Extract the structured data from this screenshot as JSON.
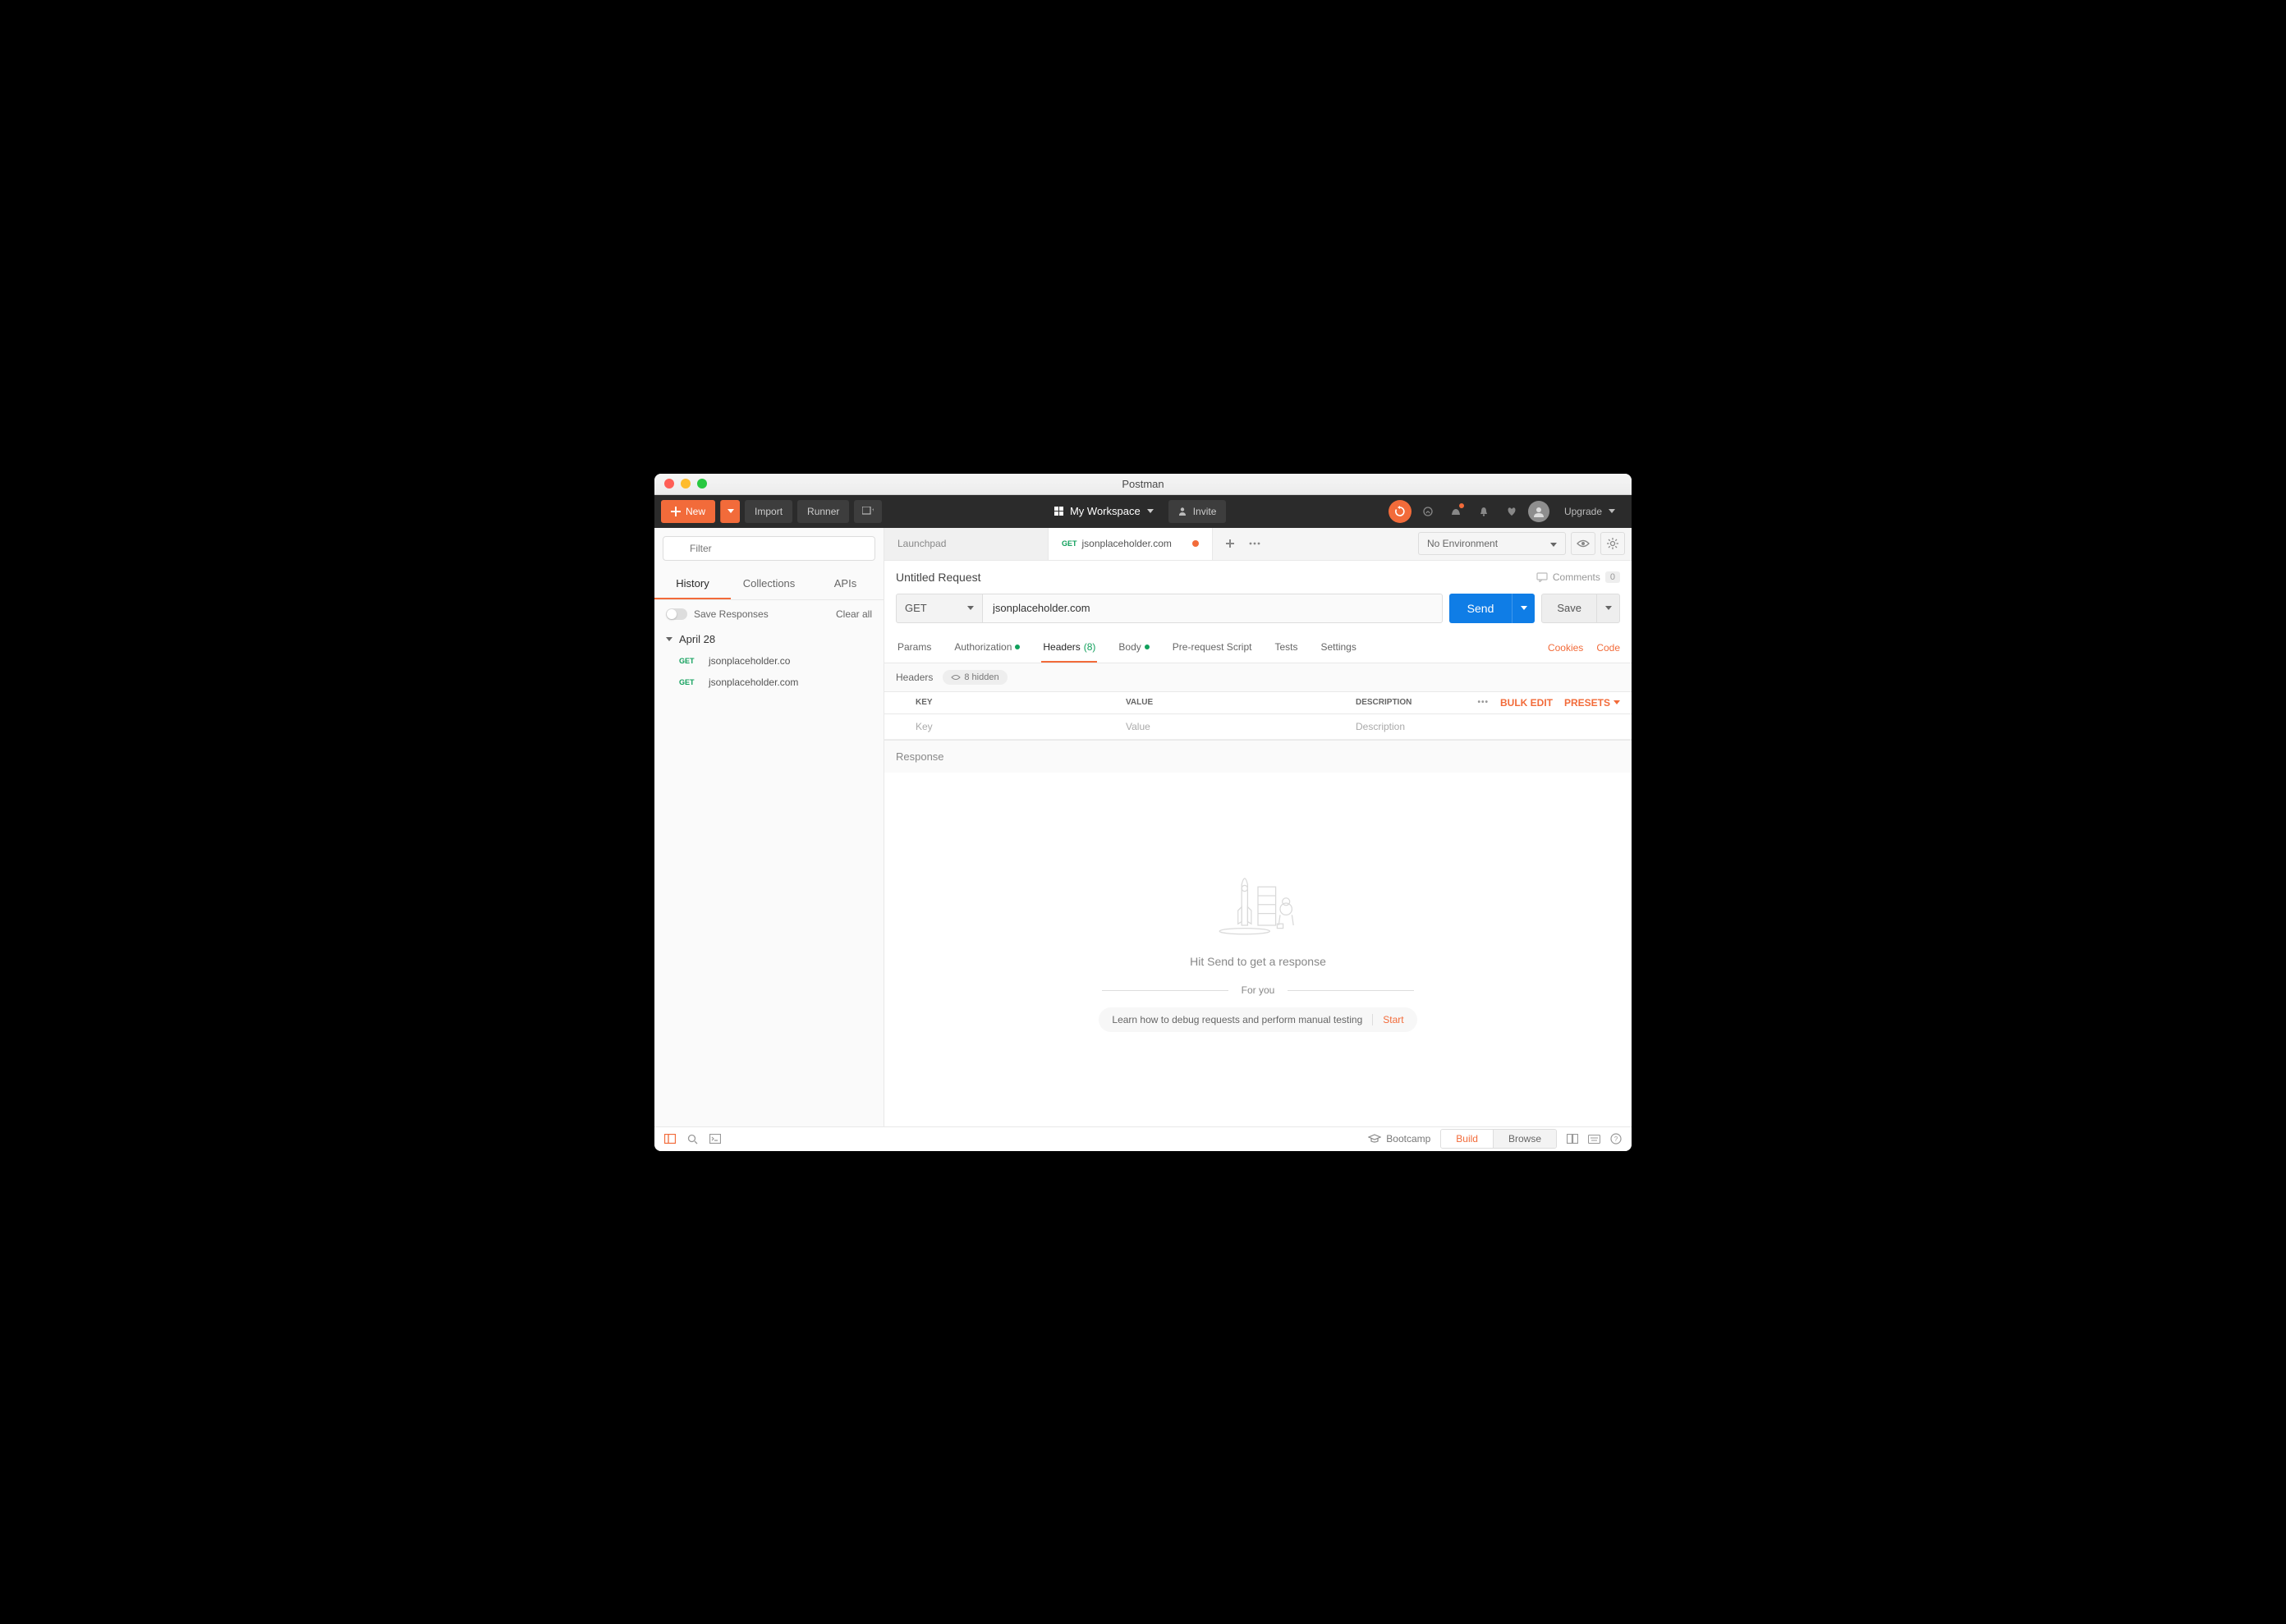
{
  "titlebar": {
    "title": "Postman"
  },
  "toolbar": {
    "new_label": "New",
    "import_label": "Import",
    "runner_label": "Runner",
    "workspace_label": "My Workspace",
    "invite_label": "Invite",
    "upgrade_label": "Upgrade"
  },
  "sidebar": {
    "filter_placeholder": "Filter",
    "tabs": {
      "history": "History",
      "collections": "Collections",
      "apis": "APIs"
    },
    "save_responses_label": "Save Responses",
    "clear_all_label": "Clear all",
    "group": {
      "date": "April 28"
    },
    "items": [
      {
        "method": "GET",
        "url": "jsonplaceholder.co"
      },
      {
        "method": "GET",
        "url": "jsonplaceholder.com"
      }
    ]
  },
  "tabs": {
    "launchpad": "Launchpad",
    "active": {
      "method": "GET",
      "label": "jsonplaceholder.com"
    }
  },
  "env": {
    "selected": "No Environment"
  },
  "request": {
    "title": "Untitled Request",
    "comments_label": "Comments",
    "comments_count": "0",
    "method": "GET",
    "url_value": "jsonplaceholder.com",
    "send_label": "Send",
    "save_label": "Save",
    "tabs": {
      "params": "Params",
      "auth": "Authorization",
      "headers": "Headers",
      "headers_count": "(8)",
      "body": "Body",
      "prerequest": "Pre-request Script",
      "tests": "Tests",
      "settings": "Settings"
    },
    "cookies_label": "Cookies",
    "code_label": "Code",
    "headers_strip_label": "Headers",
    "hidden_label": "8 hidden",
    "table": {
      "key_header": "KEY",
      "value_header": "VALUE",
      "desc_header": "DESCRIPTION",
      "bulk_edit": "Bulk Edit",
      "presets": "Presets",
      "key_placeholder": "Key",
      "value_placeholder": "Value",
      "desc_placeholder": "Description"
    }
  },
  "response": {
    "label": "Response",
    "empty_text": "Hit Send to get a response",
    "for_you": "For you",
    "lesson_text": "Learn how to debug requests and perform manual testing",
    "start_label": "Start"
  },
  "statusbar": {
    "bootcamp": "Bootcamp",
    "build": "Build",
    "browse": "Browse"
  }
}
